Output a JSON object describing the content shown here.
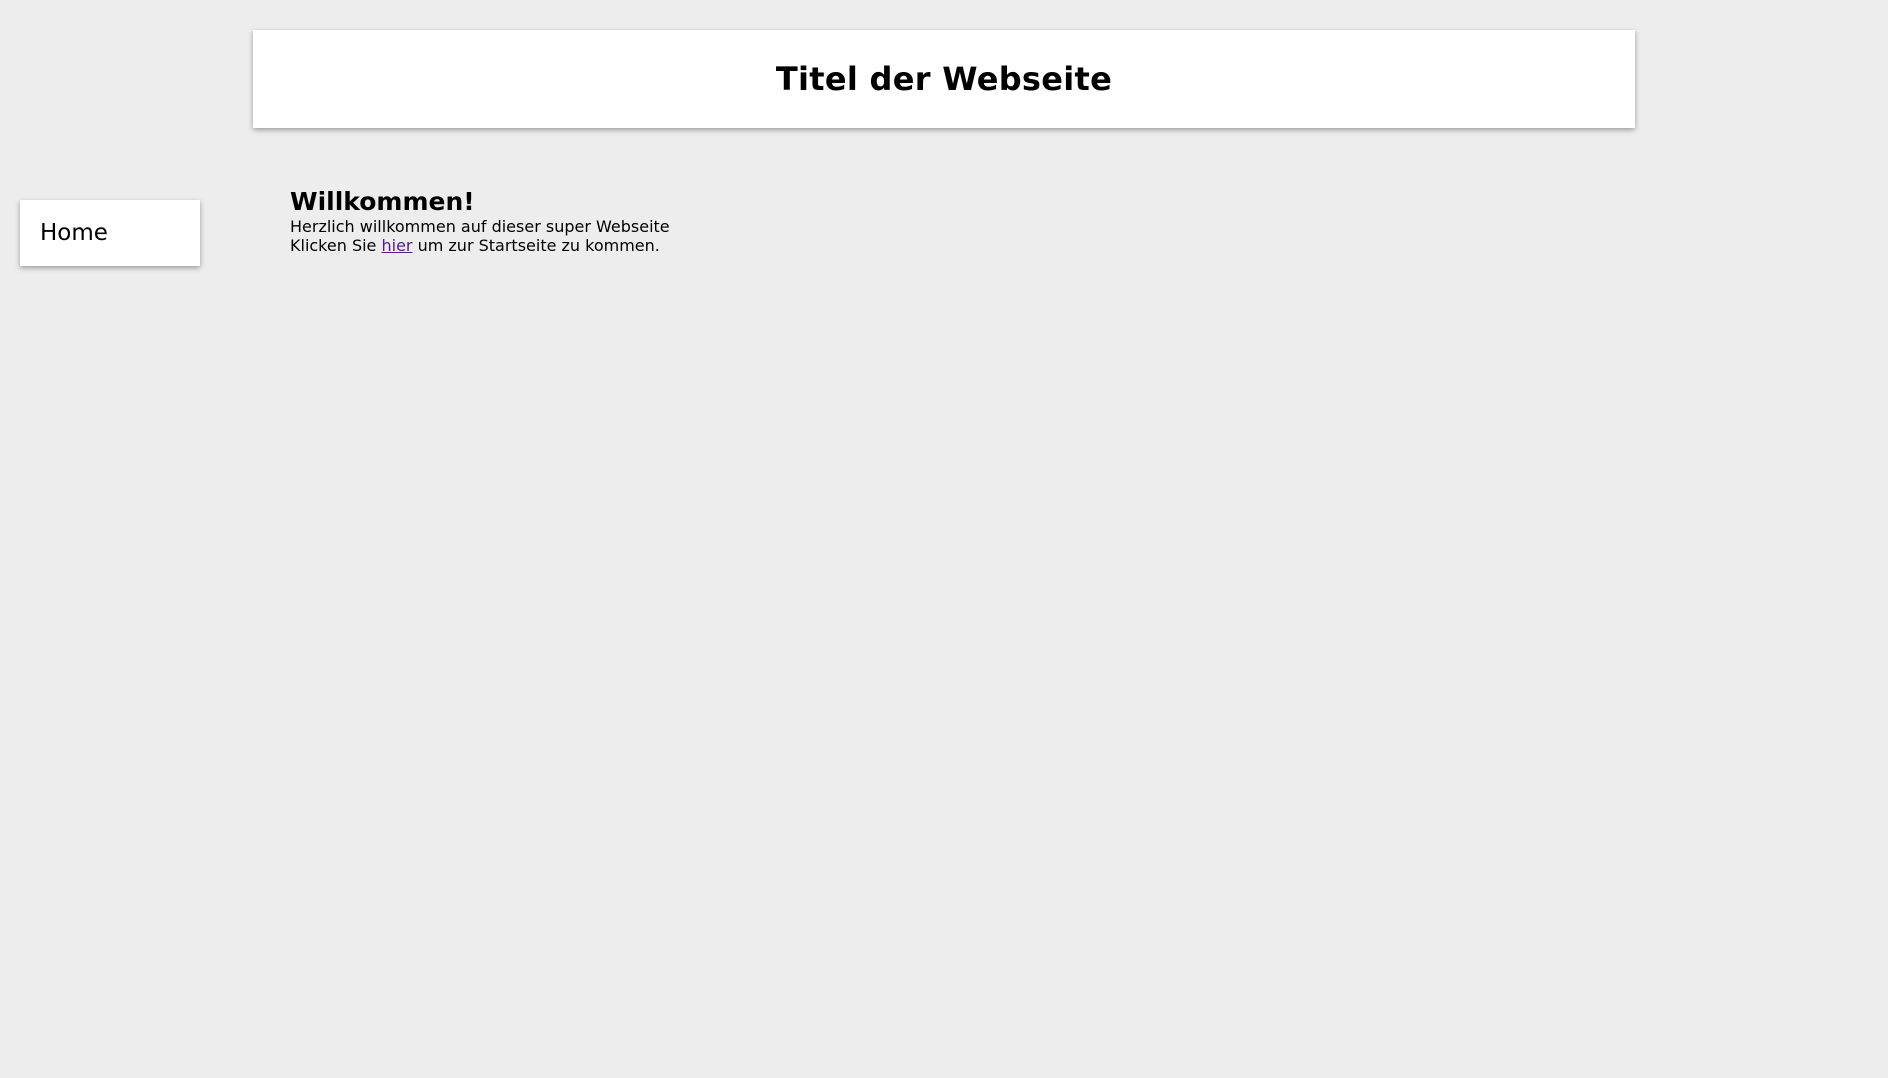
{
  "header": {
    "title": "Titel der Webseite"
  },
  "nav": {
    "items": [
      {
        "label": "Home"
      }
    ]
  },
  "main": {
    "heading": "Willkommen!",
    "intro": "Herzlich willkommen auf dieser super Webseite",
    "link_prefix": "Klicken Sie ",
    "link_text": "hier",
    "link_suffix": " um zur Startseite zu kommen."
  },
  "colors": {
    "background": "#ededed",
    "panel": "#ffffff",
    "visited_link": "#551a8b"
  }
}
